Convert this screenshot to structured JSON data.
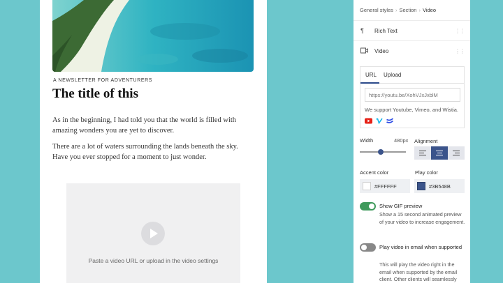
{
  "email": {
    "kicker": "A NEWSLETTER FOR ADVENTURERS",
    "title": "The title of this",
    "paragraphs": [
      "As in the beginning, I had told you that the world is filled with amazing wonders you are yet to discover.",
      "There are a lot of waters surrounding the lands beneath the sky. Have you ever stopped for a moment to just wonder."
    ],
    "video_placeholder": "Paste a video URL or upload in the video settings"
  },
  "panel": {
    "breadcrumbs": [
      "General styles",
      "Section",
      "Video"
    ],
    "blocks": [
      {
        "label": "Rich Text",
        "icon": "paragraph-icon"
      },
      {
        "label": "Video",
        "icon": "video-camera-icon"
      }
    ],
    "source_tabs": [
      "URL",
      "Upload"
    ],
    "active_tab": "URL",
    "url_placeholder": "https://youtu.be/XohVJxJxblM",
    "support_text": "We support Youtube, Vimeo, and Wistia.",
    "width_label": "Width",
    "width_value": "480px",
    "width_fraction": 0.45,
    "alignment_label": "Alignment",
    "alignment_selected": "center",
    "accent_label": "Accent color",
    "accent_value": "#FFFFFF",
    "play_label": "Play color",
    "play_value": "#3B548B",
    "gif_preview": {
      "title": "Show GIF preview",
      "description": "Show a 15 second animated preview of your video to increase engagement.",
      "enabled": true
    },
    "play_in_email": {
      "title": "Play video in email when supported",
      "description": "This will play the video right in the email when supported by the email client. Other clients will seamlessly",
      "enabled": false
    }
  },
  "colors": {
    "background": "#6cc7cc",
    "accent_blue": "#3b548b",
    "toggle_on": "#3f9a5c",
    "youtube": "#e62117",
    "vimeo": "#1ab7ea",
    "wistia": "#2949e5"
  }
}
